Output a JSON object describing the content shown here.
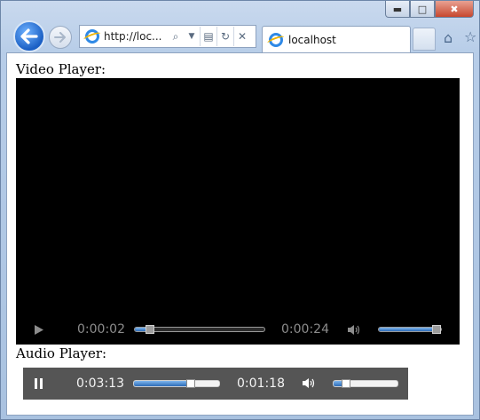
{
  "window": {
    "controls": {
      "minimize": "minimize-icon",
      "maximize": "maximize-icon",
      "close": "close-icon"
    }
  },
  "nav": {
    "back": "back-arrow-icon",
    "forward": "forward-arrow-icon",
    "address": "http://loc...",
    "address_icons": [
      "search-icon",
      "dropdown-icon",
      "compat-view-icon",
      "refresh-icon",
      "stop-icon"
    ]
  },
  "tab": {
    "title": "localhost",
    "icon": "ie-icon"
  },
  "toolbar": {
    "home": "home-icon",
    "favorites": "star-icon"
  },
  "page": {
    "video_label": "Video Player:",
    "audio_label": "Audio Player:"
  },
  "video_player": {
    "play_state": "paused",
    "current_time": "0:00:02",
    "duration": "0:00:24",
    "progress": 0.12,
    "volume": 1.0
  },
  "audio_player": {
    "play_state": "playing",
    "current_time": "0:03:13",
    "remaining_or_duration": "0:01:18",
    "progress": 0.66,
    "volume": 0.2
  },
  "colors": {
    "accent": "#2c6bb8",
    "video_bg": "#000000",
    "audio_bar_bg": "#555555"
  }
}
